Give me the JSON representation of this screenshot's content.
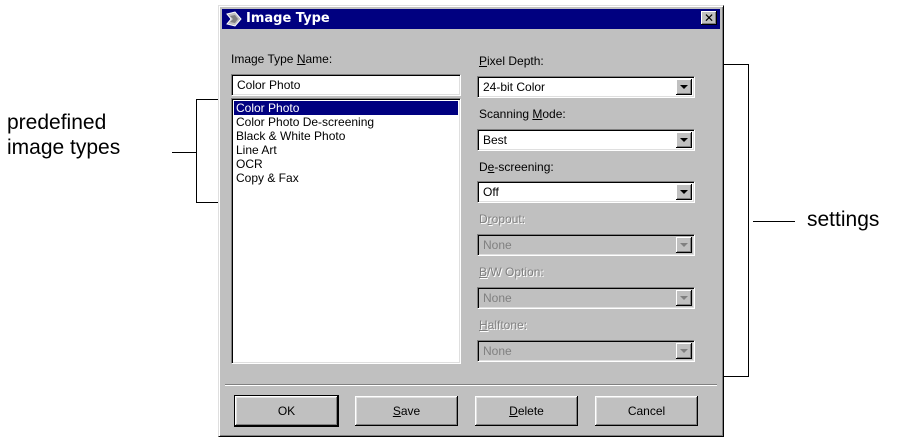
{
  "dialog": {
    "title": "Image Type",
    "close_label": "✕",
    "name_label": {
      "before": "Image Type ",
      "accel": "N",
      "after": "ame:"
    },
    "name_value": "Color Photo",
    "list_items": [
      {
        "label": "Color Photo",
        "selected": true
      },
      {
        "label": "Color Photo De-screening",
        "selected": false
      },
      {
        "label": "Black & White Photo",
        "selected": false
      },
      {
        "label": "Line Art",
        "selected": false
      },
      {
        "label": "OCR",
        "selected": false
      },
      {
        "label": "Copy & Fax",
        "selected": false
      }
    ],
    "settings": {
      "pixel_depth": {
        "label_accel": "P",
        "label_rest": "ixel Depth:",
        "value": "24-bit Color",
        "enabled": true
      },
      "scanning_mode": {
        "label_before": "Scanning ",
        "label_accel": "M",
        "label_rest": "ode:",
        "value": "Best",
        "enabled": true
      },
      "descreening": {
        "label_before": "D",
        "label_accel": "e",
        "label_rest": "-screening:",
        "value": "Off",
        "enabled": true
      },
      "dropout": {
        "label_before": "D",
        "label_accel": "r",
        "label_rest": "opout:",
        "value": "None",
        "enabled": false
      },
      "bw_option": {
        "label_accel": "B",
        "label_rest": "/W Option:",
        "value": "None",
        "enabled": false
      },
      "halftone": {
        "label_accel": "H",
        "label_rest": "alftone:",
        "value": "None",
        "enabled": false
      }
    },
    "buttons": {
      "ok": "OK",
      "save": {
        "accel": "S",
        "rest": "ave"
      },
      "delete": {
        "accel": "D",
        "rest": "elete"
      },
      "cancel": "Cancel"
    }
  },
  "annotations": {
    "left_line1": "predefined",
    "left_line2": "image types",
    "right": "settings"
  },
  "colors": {
    "title_bar": "#000080",
    "dialog_face": "#c0c0c0",
    "selection": "#000080"
  }
}
